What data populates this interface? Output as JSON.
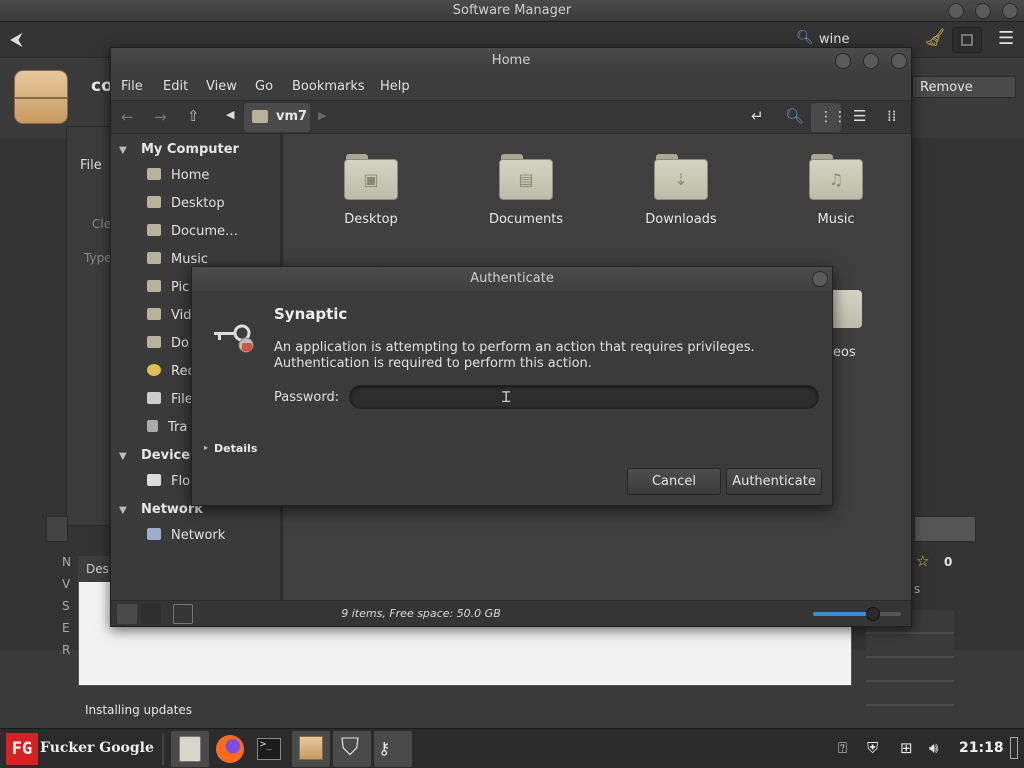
{
  "software_manager": {
    "title": "Software Manager",
    "search_value": "wine",
    "app_name_partial": "co",
    "remove_label": "Remove",
    "left_fragments": {
      "file": "File",
      "clear": "Cle",
      "type": "Type",
      "des": "Des"
    },
    "side_letters": [
      "N",
      "V",
      "S",
      "E",
      "R"
    ],
    "rating_count": "0",
    "rating_suffix": "s",
    "status_text": "Installing updates"
  },
  "files": {
    "title": "Home",
    "menu": [
      "File",
      "Edit",
      "View",
      "Go",
      "Bookmarks",
      "Help"
    ],
    "path_segment": "vm7",
    "sidebar": {
      "my_computer": "My Computer",
      "my_computer_items": [
        "Home",
        "Desktop",
        "Docume…",
        "Music",
        "Pic",
        "Vid",
        "Do",
        "Rec",
        "File",
        "Tra"
      ],
      "devices": "Devices",
      "devices_items": [
        "Flo"
      ],
      "network": "Network",
      "network_items": [
        "Network"
      ]
    },
    "folders": [
      {
        "name": "Desktop",
        "glyph": "▣"
      },
      {
        "name": "Documents",
        "glyph": "▤"
      },
      {
        "name": "Downloads",
        "glyph": "⇣"
      },
      {
        "name": "Music",
        "glyph": "♫"
      }
    ],
    "partial_folder_label": "eos",
    "status": "9 items, Free space: 50.0 GB",
    "zoom_level": 0.68
  },
  "auth_dialog": {
    "title": "Authenticate",
    "app": "Synaptic",
    "message": "An application is attempting to perform an action that requires privileges. Authentication is required to perform this action.",
    "password_label": "Password:",
    "password_value": "",
    "details_label": "Details",
    "cancel_label": "Cancel",
    "authenticate_label": "Authenticate"
  },
  "taskbar": {
    "start_logo": "FG",
    "start_label": "Fucker Google",
    "clock": "21:18"
  }
}
